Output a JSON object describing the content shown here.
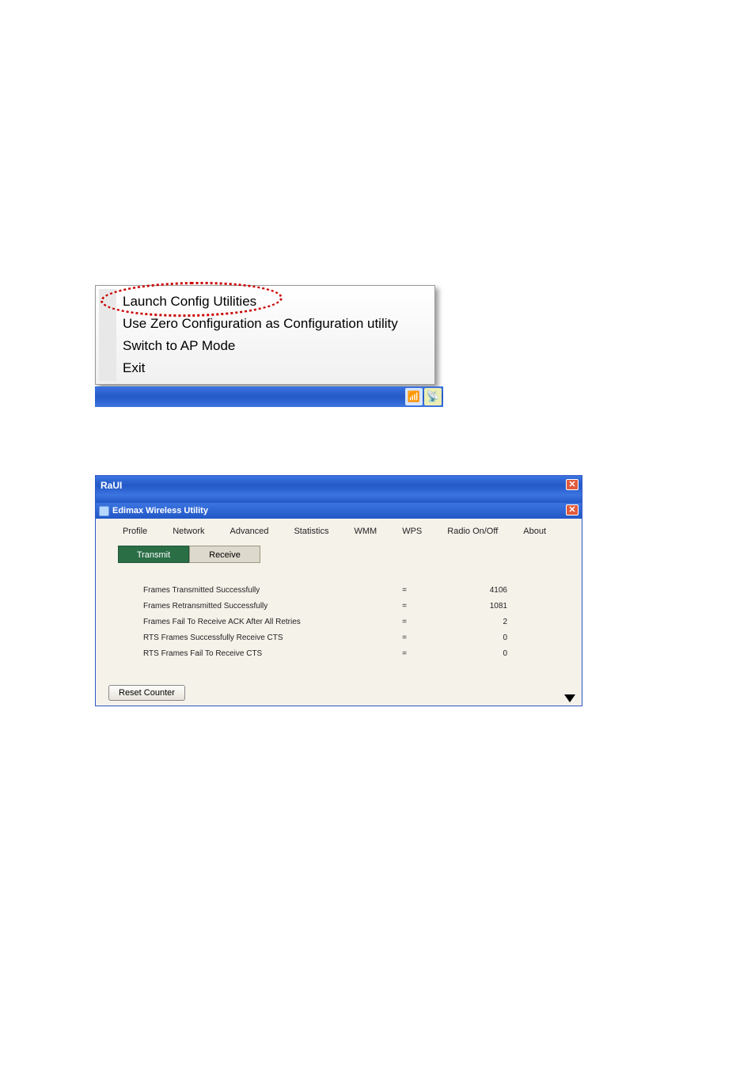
{
  "context_menu": {
    "items": [
      "Launch Config Utilities",
      "Use Zero Configuration as Configuration utility",
      "Switch to AP Mode",
      "Exit"
    ]
  },
  "raui": {
    "title": "RaUI",
    "inner_title": "Edimax Wireless Utility",
    "tabs": [
      "Profile",
      "Network",
      "Advanced",
      "Statistics",
      "WMM",
      "WPS",
      "Radio On/Off",
      "About"
    ],
    "sub_tabs": [
      "Transmit",
      "Receive"
    ],
    "stats": [
      {
        "label": "Frames Transmitted Successfully",
        "value": "4106"
      },
      {
        "label": "Frames Retransmitted Successfully",
        "value": "1081"
      },
      {
        "label": "Frames Fail To Receive ACK After All Retries",
        "value": "2"
      },
      {
        "label": "RTS Frames Successfully Receive CTS",
        "value": "0"
      },
      {
        "label": "RTS Frames Fail To Receive CTS",
        "value": "0"
      }
    ],
    "reset_label": "Reset Counter"
  }
}
